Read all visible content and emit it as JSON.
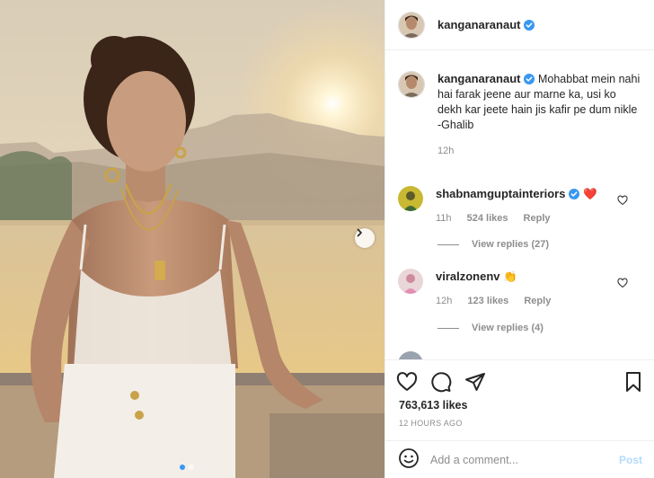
{
  "post": {
    "author": "kanganaranaut",
    "caption": "Mohabbat mein nahi hai farak jeene aur marne ka, usi ko dekh kar jeete hain jis kafir pe dum nikle\n-Ghalib",
    "caption_time": "12h",
    "likes": "763,613 likes",
    "posted_ago": "12 HOURS AGO",
    "carousel": {
      "slide_count": 2,
      "active_slide": 1
    }
  },
  "comments": [
    {
      "username": "shabnamguptainteriors",
      "verified": true,
      "text": "❤️",
      "time": "11h",
      "likes": "524 likes",
      "reply_label": "Reply",
      "view_replies": "View replies (27)"
    },
    {
      "username": "viralzonenv",
      "verified": false,
      "text": "👏",
      "time": "12h",
      "likes": "123 likes",
      "reply_label": "Reply",
      "view_replies": "View replies (4)"
    }
  ],
  "composer": {
    "placeholder": "Add a comment...",
    "post_label": "Post"
  },
  "icons": {
    "verified": "verified-badge-icon",
    "like": "heart-icon",
    "comment": "comment-icon",
    "share": "share-icon",
    "save": "bookmark-icon",
    "emoji": "emoji-icon",
    "next": "chevron-right-icon"
  },
  "colors": {
    "verified": "#3897f0",
    "post_disabled": "#b3dbff",
    "muted": "#8e8e8e",
    "text": "#262626"
  }
}
